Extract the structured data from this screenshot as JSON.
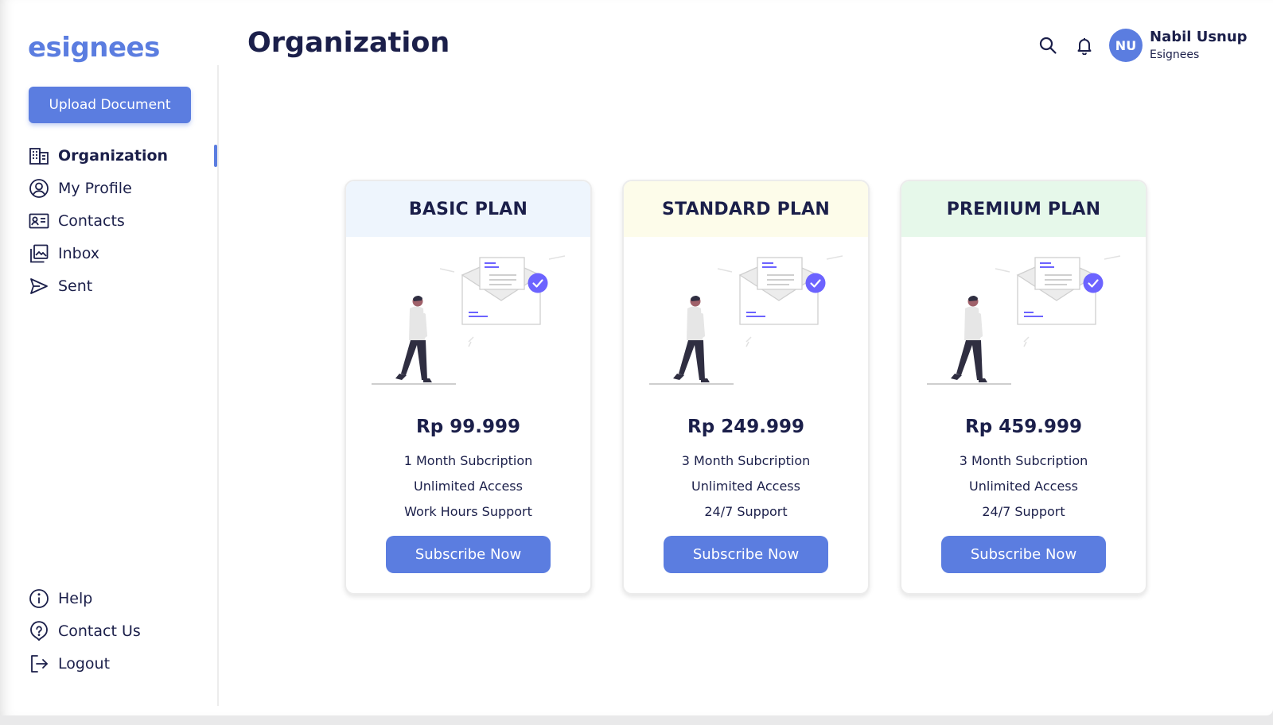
{
  "brand": {
    "logo_text": "esignees",
    "accent": "#5b7de0"
  },
  "sidebar": {
    "upload_label": "Upload Document",
    "items": [
      {
        "label": "Organization",
        "icon": "organization-icon",
        "active": true
      },
      {
        "label": "My Profile",
        "icon": "profile-icon"
      },
      {
        "label": "Contacts",
        "icon": "contacts-icon"
      },
      {
        "label": "Inbox",
        "icon": "inbox-icon"
      },
      {
        "label": "Sent",
        "icon": "send-icon"
      }
    ],
    "bottom_items": [
      {
        "label": "Help",
        "icon": "info-icon"
      },
      {
        "label": "Contact Us",
        "icon": "question-icon"
      },
      {
        "label": "Logout",
        "icon": "logout-icon"
      }
    ]
  },
  "header": {
    "title": "Organization",
    "icons": [
      "search-icon",
      "bell-icon"
    ],
    "user": {
      "initials": "NU",
      "name": "Nabil Usnup",
      "org": "Esignees"
    }
  },
  "plans": [
    {
      "name": "BASIC PLAN",
      "header_color": "#eef5fd",
      "price": "Rp 99.999",
      "features": [
        "1 Month Subcription",
        "Unlimited Access",
        "Work Hours Support"
      ],
      "cta": "Subscribe Now"
    },
    {
      "name": "STANDARD PLAN",
      "header_color": "#fdfcea",
      "price": "Rp 249.999",
      "features": [
        "3 Month Subcription",
        "Unlimited Access",
        "24/7 Support"
      ],
      "cta": "Subscribe Now"
    },
    {
      "name": "PREMIUM PLAN",
      "header_color": "#e6f8ea",
      "price": "Rp 459.999",
      "features": [
        "3 Month Subcription",
        "Unlimited Access",
        "24/7 Support"
      ],
      "cta": "Subscribe Now"
    }
  ]
}
